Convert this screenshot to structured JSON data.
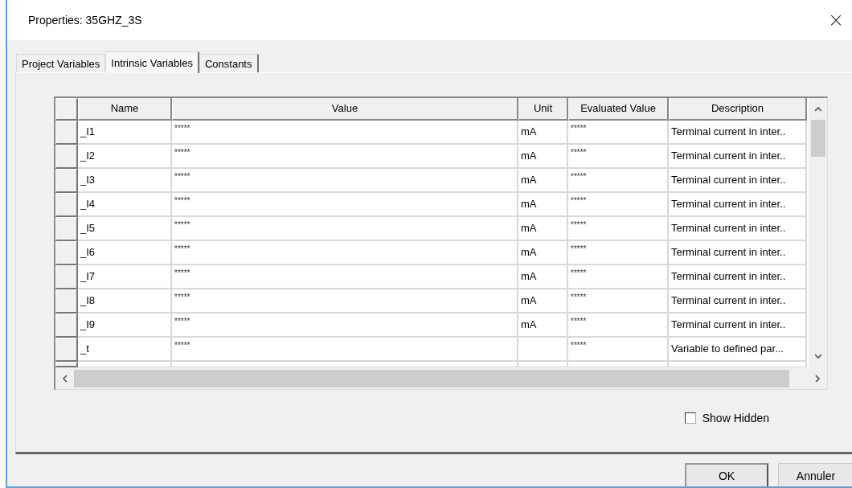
{
  "window": {
    "title": "Properties: 35GHZ_3S",
    "close": "×"
  },
  "tabs": [
    {
      "label": "Project Variables",
      "selected": false
    },
    {
      "label": "Intrinsic Variables",
      "selected": true
    },
    {
      "label": "Constants",
      "selected": false
    }
  ],
  "table": {
    "columns": [
      "Name",
      "Value",
      "Unit",
      "Evaluated Value",
      "Description"
    ],
    "rows": [
      {
        "name": "_I1",
        "value": "*****",
        "unit": "mA",
        "evaluated_value": "*****",
        "description": "Terminal current in inter.."
      },
      {
        "name": "_I2",
        "value": "*****",
        "unit": "mA",
        "evaluated_value": "*****",
        "description": "Terminal current in inter.."
      },
      {
        "name": "_I3",
        "value": "*****",
        "unit": "mA",
        "evaluated_value": "*****",
        "description": "Terminal current in inter.."
      },
      {
        "name": "_I4",
        "value": "*****",
        "unit": "mA",
        "evaluated_value": "*****",
        "description": "Terminal current in inter.."
      },
      {
        "name": "_I5",
        "value": "*****",
        "unit": "mA",
        "evaluated_value": "*****",
        "description": "Terminal current in inter.."
      },
      {
        "name": "_I6",
        "value": "*****",
        "unit": "mA",
        "evaluated_value": "*****",
        "description": "Terminal current in inter.."
      },
      {
        "name": "_I7",
        "value": "*****",
        "unit": "mA",
        "evaluated_value": "*****",
        "description": "Terminal current in inter.."
      },
      {
        "name": "_I8",
        "value": "*****",
        "unit": "mA",
        "evaluated_value": "*****",
        "description": "Terminal current in inter.."
      },
      {
        "name": "_I9",
        "value": "*****",
        "unit": "mA",
        "evaluated_value": "*****",
        "description": "Terminal current in inter.."
      },
      {
        "name": "_t",
        "value": "*****",
        "unit": "",
        "evaluated_value": "*****",
        "description": "Variable to defined par..."
      }
    ]
  },
  "show_hidden": {
    "label": "Show Hidden",
    "checked": false
  },
  "buttons": [
    {
      "label": "OK",
      "default": true
    },
    {
      "label": "Annuler",
      "default": false
    }
  ]
}
